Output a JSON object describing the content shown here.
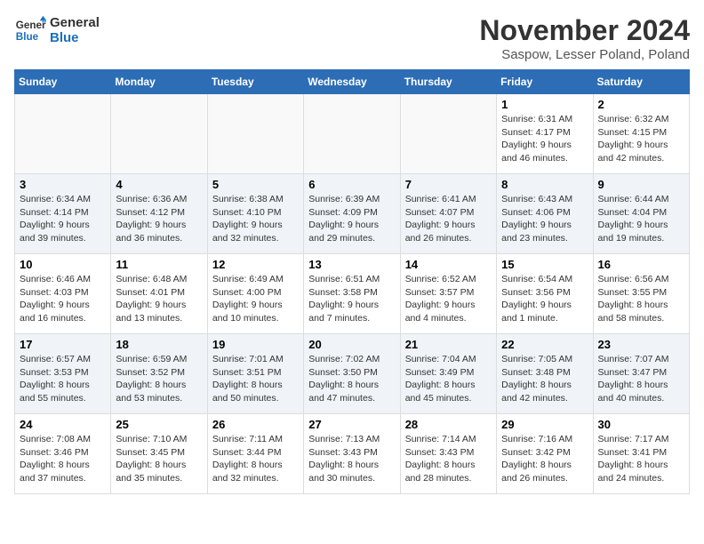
{
  "logo": {
    "text_general": "General",
    "text_blue": "Blue"
  },
  "header": {
    "month": "November 2024",
    "location": "Saspow, Lesser Poland, Poland"
  },
  "weekdays": [
    "Sunday",
    "Monday",
    "Tuesday",
    "Wednesday",
    "Thursday",
    "Friday",
    "Saturday"
  ],
  "weeks": [
    [
      {
        "day": "",
        "info": ""
      },
      {
        "day": "",
        "info": ""
      },
      {
        "day": "",
        "info": ""
      },
      {
        "day": "",
        "info": ""
      },
      {
        "day": "",
        "info": ""
      },
      {
        "day": "1",
        "info": "Sunrise: 6:31 AM\nSunset: 4:17 PM\nDaylight: 9 hours and 46 minutes."
      },
      {
        "day": "2",
        "info": "Sunrise: 6:32 AM\nSunset: 4:15 PM\nDaylight: 9 hours and 42 minutes."
      }
    ],
    [
      {
        "day": "3",
        "info": "Sunrise: 6:34 AM\nSunset: 4:14 PM\nDaylight: 9 hours and 39 minutes."
      },
      {
        "day": "4",
        "info": "Sunrise: 6:36 AM\nSunset: 4:12 PM\nDaylight: 9 hours and 36 minutes."
      },
      {
        "day": "5",
        "info": "Sunrise: 6:38 AM\nSunset: 4:10 PM\nDaylight: 9 hours and 32 minutes."
      },
      {
        "day": "6",
        "info": "Sunrise: 6:39 AM\nSunset: 4:09 PM\nDaylight: 9 hours and 29 minutes."
      },
      {
        "day": "7",
        "info": "Sunrise: 6:41 AM\nSunset: 4:07 PM\nDaylight: 9 hours and 26 minutes."
      },
      {
        "day": "8",
        "info": "Sunrise: 6:43 AM\nSunset: 4:06 PM\nDaylight: 9 hours and 23 minutes."
      },
      {
        "day": "9",
        "info": "Sunrise: 6:44 AM\nSunset: 4:04 PM\nDaylight: 9 hours and 19 minutes."
      }
    ],
    [
      {
        "day": "10",
        "info": "Sunrise: 6:46 AM\nSunset: 4:03 PM\nDaylight: 9 hours and 16 minutes."
      },
      {
        "day": "11",
        "info": "Sunrise: 6:48 AM\nSunset: 4:01 PM\nDaylight: 9 hours and 13 minutes."
      },
      {
        "day": "12",
        "info": "Sunrise: 6:49 AM\nSunset: 4:00 PM\nDaylight: 9 hours and 10 minutes."
      },
      {
        "day": "13",
        "info": "Sunrise: 6:51 AM\nSunset: 3:58 PM\nDaylight: 9 hours and 7 minutes."
      },
      {
        "day": "14",
        "info": "Sunrise: 6:52 AM\nSunset: 3:57 PM\nDaylight: 9 hours and 4 minutes."
      },
      {
        "day": "15",
        "info": "Sunrise: 6:54 AM\nSunset: 3:56 PM\nDaylight: 9 hours and 1 minute."
      },
      {
        "day": "16",
        "info": "Sunrise: 6:56 AM\nSunset: 3:55 PM\nDaylight: 8 hours and 58 minutes."
      }
    ],
    [
      {
        "day": "17",
        "info": "Sunrise: 6:57 AM\nSunset: 3:53 PM\nDaylight: 8 hours and 55 minutes."
      },
      {
        "day": "18",
        "info": "Sunrise: 6:59 AM\nSunset: 3:52 PM\nDaylight: 8 hours and 53 minutes."
      },
      {
        "day": "19",
        "info": "Sunrise: 7:01 AM\nSunset: 3:51 PM\nDaylight: 8 hours and 50 minutes."
      },
      {
        "day": "20",
        "info": "Sunrise: 7:02 AM\nSunset: 3:50 PM\nDaylight: 8 hours and 47 minutes."
      },
      {
        "day": "21",
        "info": "Sunrise: 7:04 AM\nSunset: 3:49 PM\nDaylight: 8 hours and 45 minutes."
      },
      {
        "day": "22",
        "info": "Sunrise: 7:05 AM\nSunset: 3:48 PM\nDaylight: 8 hours and 42 minutes."
      },
      {
        "day": "23",
        "info": "Sunrise: 7:07 AM\nSunset: 3:47 PM\nDaylight: 8 hours and 40 minutes."
      }
    ],
    [
      {
        "day": "24",
        "info": "Sunrise: 7:08 AM\nSunset: 3:46 PM\nDaylight: 8 hours and 37 minutes."
      },
      {
        "day": "25",
        "info": "Sunrise: 7:10 AM\nSunset: 3:45 PM\nDaylight: 8 hours and 35 minutes."
      },
      {
        "day": "26",
        "info": "Sunrise: 7:11 AM\nSunset: 3:44 PM\nDaylight: 8 hours and 32 minutes."
      },
      {
        "day": "27",
        "info": "Sunrise: 7:13 AM\nSunset: 3:43 PM\nDaylight: 8 hours and 30 minutes."
      },
      {
        "day": "28",
        "info": "Sunrise: 7:14 AM\nSunset: 3:43 PM\nDaylight: 8 hours and 28 minutes."
      },
      {
        "day": "29",
        "info": "Sunrise: 7:16 AM\nSunset: 3:42 PM\nDaylight: 8 hours and 26 minutes."
      },
      {
        "day": "30",
        "info": "Sunrise: 7:17 AM\nSunset: 3:41 PM\nDaylight: 8 hours and 24 minutes."
      }
    ]
  ]
}
